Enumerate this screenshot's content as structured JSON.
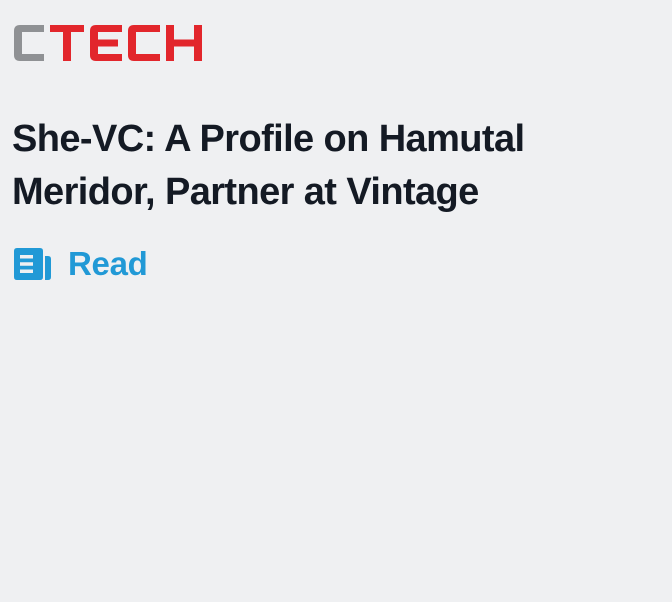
{
  "brand": {
    "logo_text": "CTECH",
    "colors": {
      "logo_c": "#8f9194",
      "logo_tech": "#e2262c",
      "headline": "#141a24",
      "accent": "#2199d6",
      "background": "#eff0f2"
    }
  },
  "article": {
    "headline": "She-VC: A Profile on Hamutal Meridor, Partner at Vintage",
    "action": {
      "icon": "newspaper-icon",
      "label": "Read"
    }
  }
}
